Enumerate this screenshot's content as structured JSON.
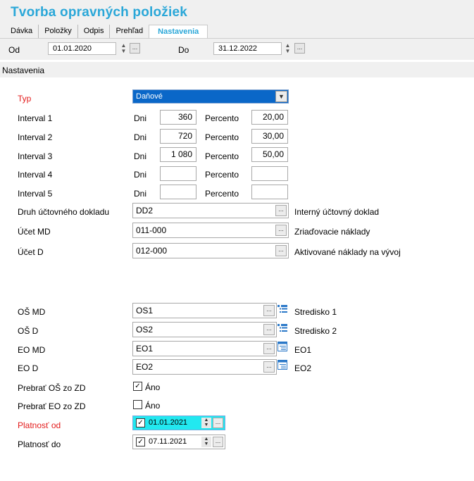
{
  "window": {
    "title": "Tvorba opravných položiek"
  },
  "tabs": [
    {
      "label": "Dávka"
    },
    {
      "label": "Položky"
    },
    {
      "label": "Odpis"
    },
    {
      "label": "Prehľad"
    },
    {
      "label": "Nastavenia",
      "active": true
    }
  ],
  "period": {
    "from_label": "Od",
    "from_value": "01.01.2020",
    "to_label": "Do",
    "to_value": "31.12.2022"
  },
  "section": {
    "title": "Nastavenia"
  },
  "form": {
    "typ": {
      "label": "Typ",
      "value": "Daňové"
    },
    "intervals": [
      {
        "label": "Interval 1",
        "days_label": "Dni",
        "days": "360",
        "percent_label": "Percento",
        "percent": "20,00"
      },
      {
        "label": "Interval 2",
        "days_label": "Dni",
        "days": "720",
        "percent_label": "Percento",
        "percent": "30,00"
      },
      {
        "label": "Interval 3",
        "days_label": "Dni",
        "days": "1 080",
        "percent_label": "Percento",
        "percent": "50,00"
      },
      {
        "label": "Interval 4",
        "days_label": "Dni",
        "days": "",
        "percent_label": "Percento",
        "percent": ""
      },
      {
        "label": "Interval 5",
        "days_label": "Dni",
        "days": "",
        "percent_label": "Percento",
        "percent": ""
      }
    ],
    "druh": {
      "label": "Druh účtovného dokladu",
      "value": "DD2",
      "description": "Interný účtovný doklad"
    },
    "ucet_md": {
      "label": "Účet MD",
      "value": "011-000",
      "description": "Zriaďovacie náklady"
    },
    "ucet_d": {
      "label": "Účet D",
      "value": "012-000",
      "description": "Aktivované náklady na vývoj"
    },
    "os_md": {
      "label": "OŠ MD",
      "value": "OS1",
      "description": "Stredisko 1"
    },
    "os_d": {
      "label": "OŠ D",
      "value": "OS2",
      "description": "Stredisko 2"
    },
    "eo_md": {
      "label": "EO MD",
      "value": "EO1",
      "description": "EO1"
    },
    "eo_d": {
      "label": "EO D",
      "value": "EO2",
      "description": "EO2"
    },
    "prebrat_os": {
      "label": "Prebrať OŠ zo ZD",
      "checked": true,
      "text": "Áno"
    },
    "prebrat_eo": {
      "label": "Prebrať EO zo ZD",
      "checked": false,
      "text": "Áno"
    },
    "platnost_od": {
      "label": "Platnosť od",
      "checked": true,
      "value": "01.01.2021"
    },
    "platnost_do": {
      "label": "Platnosť do",
      "checked": true,
      "value": "07.11.2021"
    }
  },
  "colors": {
    "accent": "#2aa7d8",
    "required_label": "#e31c1c",
    "selection": "#0a67c8",
    "highlight": "#22e8f0"
  }
}
